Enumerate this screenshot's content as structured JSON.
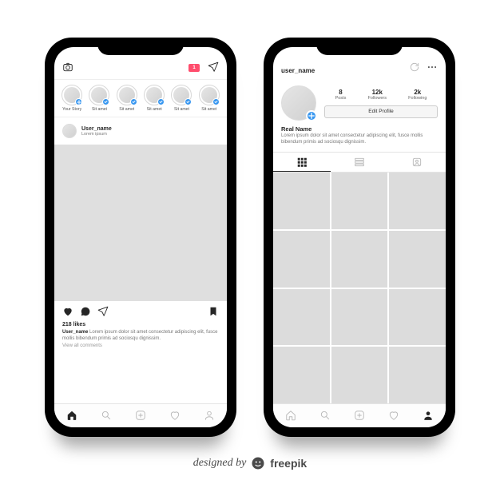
{
  "feed": {
    "dm_count": "1",
    "stories": [
      {
        "label": "Your Story"
      },
      {
        "label": "Sit amet"
      },
      {
        "label": "Sit amet"
      },
      {
        "label": "Sit amet"
      },
      {
        "label": "Sit amet"
      },
      {
        "label": "Sit amet"
      }
    ],
    "post": {
      "username": "User_name",
      "location": "Lorem ipsum",
      "likes": "218 likes",
      "caption_user": "User_name",
      "caption": "Lorem ipsum dolor sit amet consectetur adipiscing elit, fusce mollis bibendum primis ad sociosqu dignissim.",
      "view_comments": "View all comments"
    }
  },
  "profile": {
    "username": "user_name",
    "stats": {
      "posts_n": "8",
      "posts_l": "Posts",
      "followers_n": "12k",
      "followers_l": "Followers",
      "following_n": "2k",
      "following_l": "Following"
    },
    "edit_label": "Edit Profile",
    "real_name": "Real Name",
    "bio": "Lorem ipsum dolor sit amet consectetur adipiscing elit, fusce mollis bibendum primis ad sociosqu dignissim."
  },
  "credit": {
    "prefix": "designed by",
    "brand": "freepik"
  }
}
